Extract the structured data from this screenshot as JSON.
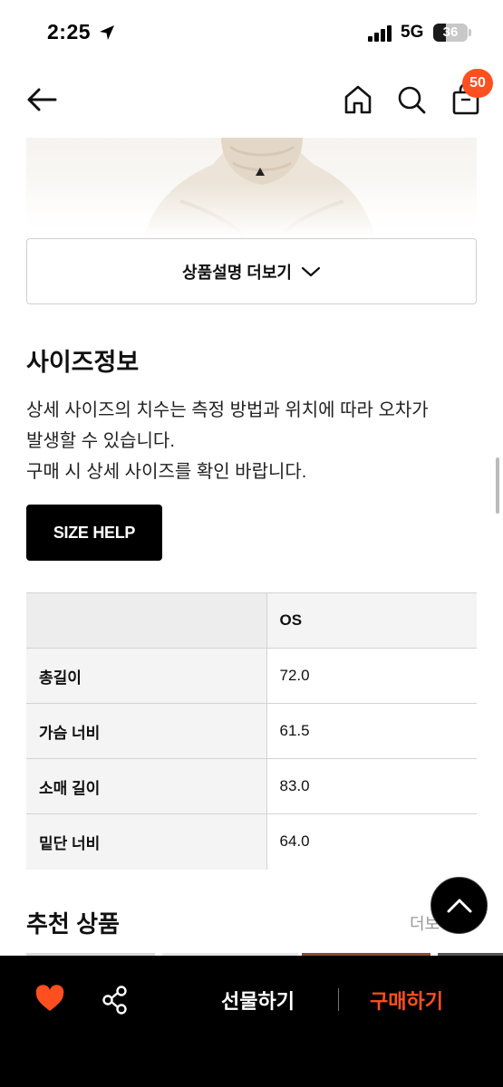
{
  "status_bar": {
    "time": "2:25",
    "network": "5G",
    "battery": "36",
    "battery_level": 0.36
  },
  "nav": {
    "back_icon": "arrow-left-icon",
    "home_icon": "home-icon",
    "search_icon": "search-icon",
    "cart_icon": "shopping-bag-icon",
    "cart_count": "50"
  },
  "product": {
    "more_description_label": "상품설명 더보기"
  },
  "size_info": {
    "title": "사이즈정보",
    "description_lines": [
      "상세 사이즈의 치수는 측정 방법과 위치에 따라 오차가",
      "발생할 수 있습니다.",
      "구매 시 상세 사이즈를 확인 바랍니다."
    ],
    "size_help_label": "SIZE HELP",
    "table": {
      "size_header": "OS",
      "rows": [
        {
          "label": "총길이",
          "value": "72.0"
        },
        {
          "label": "가슴 너비",
          "value": "61.5"
        },
        {
          "label": "소매 길이",
          "value": "83.0"
        },
        {
          "label": "밑단 너비",
          "value": "64.0"
        }
      ]
    }
  },
  "recommended": {
    "title": "추천 상품",
    "more_label": "더보기"
  },
  "bottom_bar": {
    "like_icon": "heart-icon",
    "share_icon": "share-icon",
    "gift_label": "선물하기",
    "buy_label": "구매하기"
  },
  "colors": {
    "accent": "#ff4f1f",
    "bar_background": "#000000"
  }
}
